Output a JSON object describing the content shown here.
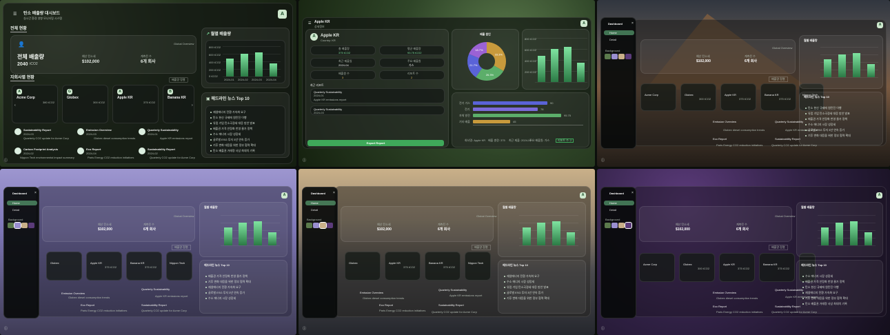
{
  "header": {
    "title": "탄소 배출량 대시보드",
    "subtitle": "실시간 환경 영향 모니터링 시스템",
    "avatar": "A"
  },
  "summary": {
    "section_title": "전체 현황",
    "label": "전체 배출량",
    "value": "2040",
    "unit": "tCO2",
    "cost_label": "예산 탄소세",
    "cost_value": "$102,000",
    "companies_label": "계측된 수",
    "companies_value": "6개 회사",
    "global_label": "Global Overview"
  },
  "monthly": {
    "title": "월별 배출량",
    "y_ticks": [
      "800 tCO2",
      "600 tCO2",
      "400 tCO2",
      "200 tCO2",
      "0 tCO2"
    ],
    "x_ticks": [
      "2024-01",
      "2024-02",
      "2024-03",
      "2024-04"
    ]
  },
  "chart_data": {
    "type": "bar",
    "title": "월별 배출량",
    "categories": [
      "2024-01",
      "2024-02",
      "2024-03",
      "2024-04"
    ],
    "values": [
      480,
      600,
      640,
      350
    ],
    "ylim": [
      0,
      800
    ],
    "ylabel": "tCO2"
  },
  "site": {
    "title": "자회사별 현황",
    "sort_label": "배출량 정렬"
  },
  "companies": [
    {
      "name": "Acme Corp",
      "value": "380 tCO2",
      "avatar": "A"
    },
    {
      "name": "Globex",
      "value": "300 tCO2",
      "avatar": "G"
    },
    {
      "name": "Apple KR",
      "value": "375 tCO2",
      "avatar": "A"
    },
    {
      "name": "Banana KR",
      "value": "375 tCO2",
      "avatar": "B"
    }
  ],
  "news": {
    "title": "헤드라인 뉴스 Top 10",
    "items": [
      "재생에너지 전환 가속화 요구",
      "탄소 헌신 규제에 원탄진 이행",
      "유럽 기업 탄소국경세 대응 방안 발표",
      "배출권 가격 안정화 반영 물가 정책",
      "수소 에너지 시장 성장세",
      "글로벌 ESG 투자 3년 연속 증가",
      "기후 변화 대응을 위한 정부 협력 확대",
      "탄소 배출권 거래량 사상 최대치 기록"
    ]
  },
  "reports": [
    {
      "title": "Sustainability Report",
      "date": "2024-03",
      "desc": "Quarterly CO2 update for Acme Corp"
    },
    {
      "title": "Emission Overview",
      "date": "2024-03",
      "desc": "Globex diesel consumption trends"
    },
    {
      "title": "Quarterly Sustainability",
      "date": "2024-01",
      "desc": "Apple KR emissions report"
    },
    {
      "title": "Carbon Footprint Analysis",
      "date": "2024-02",
      "desc": "Nippon Tech environmental impact summary"
    },
    {
      "title": "Eco Report",
      "date": "2024-04",
      "desc": "Paris Energy CO2 reduction initiatives"
    },
    {
      "title": "Sustainability Report",
      "date": "2024-02",
      "desc": "Quarterly CO2 update for Acme Corp"
    }
  ],
  "detail": {
    "company": "Apple KR",
    "country": "Country: KR",
    "header_label": "상세정보",
    "stats": [
      {
        "label": "총 배출량",
        "value": "375 tCO2"
      },
      {
        "label": "평균 배출량",
        "value": "93.75 tCO2"
      },
      {
        "label": "최근 제출일",
        "value": "2024-04"
      },
      {
        "label": "주요 배출원",
        "value": "가스"
      },
      {
        "label": "배출원 수",
        "value": "3"
      },
      {
        "label": "리포트 수",
        "value": "2"
      }
    ],
    "reports_label": "최근 리포트",
    "reports": [
      {
        "title": "Quarterly Sustainability",
        "date": "2024-01",
        "desc": "Apple KR emissions report"
      },
      {
        "title": "Quarterly Sustainability",
        "date": "2024-03",
        "desc": ""
      }
    ],
    "export_label": "Export Report",
    "pie_title": "배출 원인",
    "pie": [
      {
        "name": "전기",
        "pct": "33.3%",
        "color": "#c89a3c"
      },
      {
        "name": "가스",
        "pct": "26.3%",
        "color": "#5cae6a"
      },
      {
        "name": "수송",
        "pct": "21.7%",
        "color": "#5a63d8"
      },
      {
        "name": "기타",
        "pct": "18.7%",
        "color": "#9b62d4"
      }
    ],
    "hbars": [
      {
        "name": "전기 가스",
        "value": "90",
        "color": "#5a63d8"
      },
      {
        "name": "전기",
        "value": "78",
        "color": "#7b6ad9"
      },
      {
        "name": "자체 발전",
        "value": "95.75",
        "color": "#5cae6a"
      },
      {
        "name": "기타 배출",
        "value": "45",
        "color": "#c89a3c"
      }
    ],
    "legend": [
      "회사명: Apple KR",
      "배출 총량: 375",
      "최근 제출: 2024-04",
      "주요 배출원: 가스",
      "리포트 수: 2"
    ]
  },
  "sidebar": {
    "title": "Dashboard",
    "items": [
      "Home",
      "Detail"
    ],
    "background_label": "Background"
  },
  "extra_company": "Nippon Tech"
}
